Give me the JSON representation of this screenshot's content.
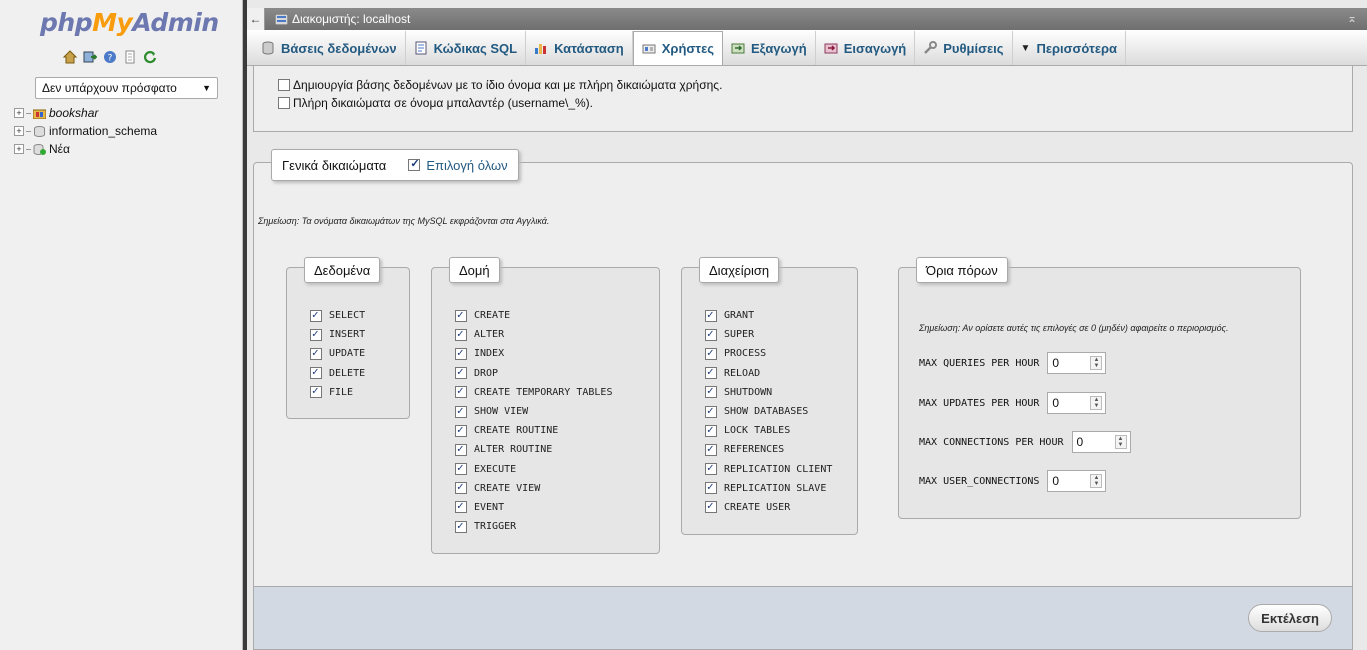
{
  "logo": {
    "php": "php",
    "my": "My",
    "admin": "Admin"
  },
  "sidebar": {
    "quick_icons": [
      "home-icon",
      "logout-icon",
      "help-icon",
      "docs-icon",
      "reload-icon"
    ],
    "recent_select": "Δεν υπάρχουν πρόσφατο",
    "tree": [
      {
        "label": "bookshar",
        "italic": true
      },
      {
        "label": "information_schema",
        "italic": false
      },
      {
        "label": "Νέα",
        "italic": false
      }
    ]
  },
  "topbar": {
    "back": "←",
    "server": "Διακομιστής: localhost",
    "collapse": "⌅"
  },
  "tabs": [
    {
      "label": "Βάσεις δεδομένων",
      "icon": "database-icon"
    },
    {
      "label": "Κώδικας SQL",
      "icon": "sql-icon"
    },
    {
      "label": "Κατάσταση",
      "icon": "status-icon"
    },
    {
      "label": "Χρήστες",
      "icon": "users-icon"
    },
    {
      "label": "Εξαγωγή",
      "icon": "export-icon"
    },
    {
      "label": "Εισαγωγή",
      "icon": "import-icon"
    },
    {
      "label": "Ρυθμίσεις",
      "icon": "settings-icon"
    },
    {
      "label": "Περισσότερα",
      "icon": "more-icon"
    }
  ],
  "top_options": {
    "create_db": "Δημιουργία βάσης δεδομένων με το ίδιο όνομα και με πλήρη δικαιώματα χρήσης.",
    "wildcard": "Πλήρη δικαιώματα σε όνομα μπαλαντέρ (username\\_%)."
  },
  "privileges": {
    "legend": "Γενικά δικαιώματα",
    "select_all": "Επιλογή όλων",
    "note": "Σημείωση: Τα ονόματα δικαιωμάτων της MySQL εκφράζονται στα Αγγλικά.",
    "groups": {
      "data": {
        "title": "Δεδομένα",
        "items": [
          "SELECT",
          "INSERT",
          "UPDATE",
          "DELETE",
          "FILE"
        ]
      },
      "structure": {
        "title": "Δομή",
        "items": [
          "CREATE",
          "ALTER",
          "INDEX",
          "DROP",
          "CREATE TEMPORARY TABLES",
          "SHOW VIEW",
          "CREATE ROUTINE",
          "ALTER ROUTINE",
          "EXECUTE",
          "CREATE VIEW",
          "EVENT",
          "TRIGGER"
        ]
      },
      "admin": {
        "title": "Διαχείριση",
        "items": [
          "GRANT",
          "SUPER",
          "PROCESS",
          "RELOAD",
          "SHUTDOWN",
          "SHOW DATABASES",
          "LOCK TABLES",
          "REFERENCES",
          "REPLICATION CLIENT",
          "REPLICATION SLAVE",
          "CREATE USER"
        ]
      }
    },
    "limits": {
      "title": "Όρια πόρων",
      "note": "Σημείωση: Αν ορίσετε αυτές τις επιλογές σε 0 (μηδέν) αφαιρείτε ο περιορισμός.",
      "rows": [
        {
          "label": "MAX QUERIES PER HOUR",
          "value": "0"
        },
        {
          "label": "MAX UPDATES PER HOUR",
          "value": "0"
        },
        {
          "label": "MAX CONNECTIONS PER HOUR",
          "value": "0"
        },
        {
          "label": "MAX USER_CONNECTIONS",
          "value": "0"
        }
      ]
    }
  },
  "footer": {
    "go": "Εκτέλεση"
  }
}
